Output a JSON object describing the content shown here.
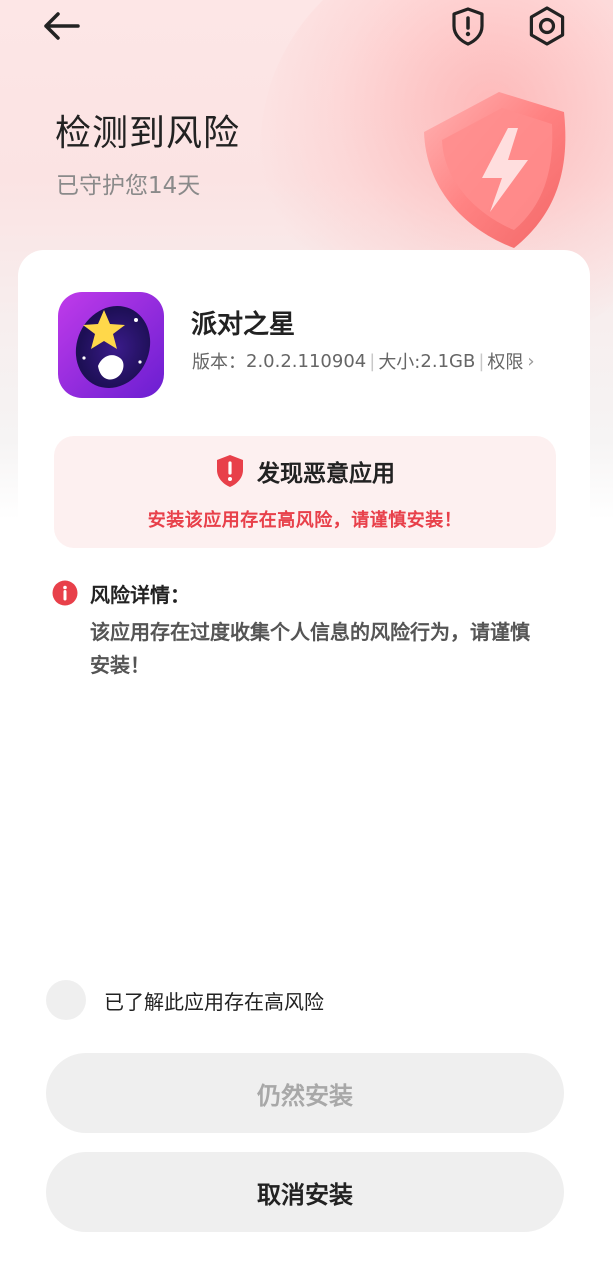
{
  "header": {
    "back_icon": "arrow-left-icon",
    "risk_icon": "shield-exclamation-icon",
    "settings_icon": "gear-icon"
  },
  "hero": {
    "title": "检测到风险",
    "subtitle": "已守护您14天",
    "illustration_icon": "shield-lightning-icon"
  },
  "app": {
    "name": "派对之星",
    "version_label": "版本：",
    "version": "2.0.2.110904",
    "size_label": "大小:",
    "size": "2.1GB",
    "permissions_label": "权限",
    "icon": "party-star-app-icon"
  },
  "alert": {
    "title": "发现恶意应用",
    "message": "安装该应用存在高风险，请谨慎安装！",
    "icon": "red-shield-exclamation-icon"
  },
  "risk_detail": {
    "title": "风险详情：",
    "body": "该应用存在过度收集个人信息的风险行为，请谨慎安装！",
    "icon": "info-exclamation-icon"
  },
  "agreement": {
    "label": "已了解此应用存在高风险",
    "checked": false
  },
  "buttons": {
    "install_anyway": "仍然安装",
    "cancel_install": "取消安装"
  },
  "colors": {
    "accent_red": "#e8404a",
    "alert_bg": "#fdf0f0",
    "button_bg": "#efefef"
  }
}
